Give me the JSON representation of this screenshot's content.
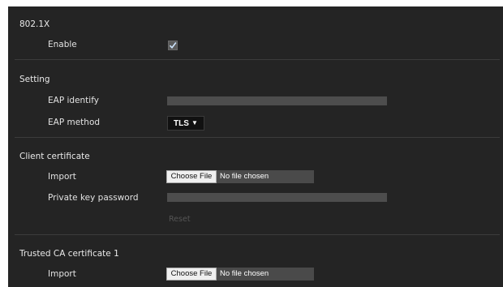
{
  "sections": {
    "dot1x": {
      "title": "802.1X",
      "enable_label": "Enable",
      "enable_checked": true
    },
    "setting": {
      "title": "Setting",
      "eap_identify_label": "EAP identify",
      "eap_identify_value": "",
      "eap_method_label": "EAP method",
      "eap_method_value": "TLS",
      "eap_method_arrow": "▼"
    },
    "client_certificate": {
      "title": "Client certificate",
      "import_label": "Import",
      "choose_file_label": "Choose File",
      "file_status": "No file chosen",
      "private_key_label": "Private key password",
      "private_key_value": "",
      "reset_label": "Reset"
    },
    "trusted_ca_1": {
      "title": "Trusted CA certificate 1",
      "import_label": "Import",
      "choose_file_label": "Choose File",
      "file_status": "No file chosen"
    }
  },
  "colors": {
    "panel_background": "#242424",
    "input_background": "#4d4d4d",
    "divider": "#3c3c3c"
  },
  "icons": {
    "checkbox": "checkmark-icon",
    "dropdown": "triangle-down-icon"
  }
}
